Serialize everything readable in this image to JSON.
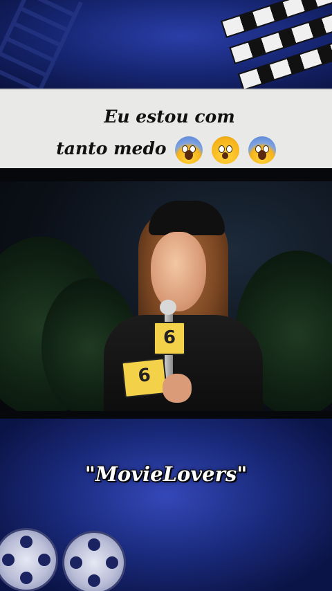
{
  "caption": {
    "line1": "Eu estou com",
    "line2": "tanto medo",
    "emojis": [
      "face-screaming-in-fear",
      "astonished-face",
      "face-screaming-in-fear"
    ]
  },
  "video": {
    "mic_flag_label": "6"
  },
  "watermark": {
    "text": "\"MovieLovers\""
  },
  "colors": {
    "background": "#15246e",
    "caption_band": "#e9e9e7",
    "caption_text": "#111111",
    "watermark_text": "#ffffff"
  }
}
